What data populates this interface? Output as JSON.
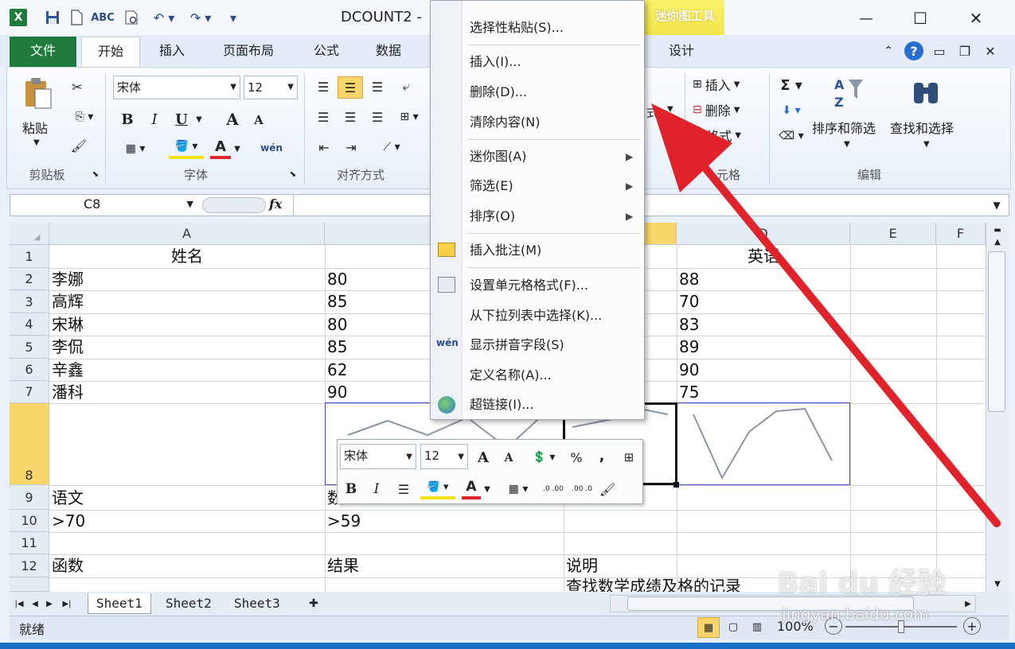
{
  "window": {
    "title": "DCOUNT2 -",
    "close_glyph": "✕",
    "maximize_glyph": "☐",
    "minimize_glyph": "—"
  },
  "context_tab_group": "迷你图工具",
  "tabs": [
    "文件",
    "开始",
    "插入",
    "页面布局",
    "公式",
    "数据",
    "设计"
  ],
  "ribbon": {
    "paste_label": "粘贴",
    "font_name": "宋体",
    "font_size": "12",
    "insert_label": "插入",
    "delete_label": "删除",
    "format_label": "格式",
    "format_partial": "式",
    "sort_filter_label": "排序和筛选",
    "find_select_label": "查找和选择",
    "group_labels": {
      "clipboard": "剪贴板",
      "font": "字体",
      "alignment": "对齐方式",
      "cells": "单元格",
      "cells_partial": "元格",
      "editing": "编辑"
    },
    "bold": "B",
    "italic": "I",
    "underline": "U",
    "grow_font": "A",
    "shrink_font": "A",
    "font_color": "A",
    "phonetic": "wén"
  },
  "formula_bar": {
    "name_box": "C8",
    "fx": "fx",
    "formula": ""
  },
  "columns": [
    "A",
    "C",
    "D",
    "E",
    "F"
  ],
  "rows": [
    {
      "num": "1",
      "a": "姓名",
      "b": "",
      "d": "英语"
    },
    {
      "num": "2",
      "a": "李娜",
      "b": "80",
      "d": "88"
    },
    {
      "num": "3",
      "a": "高辉",
      "b": "85",
      "d": "70"
    },
    {
      "num": "4",
      "a": "宋琳",
      "b": "80",
      "d": "83"
    },
    {
      "num": "5",
      "a": "李侃",
      "b": "85",
      "d": "89"
    },
    {
      "num": "6",
      "a": "辛鑫",
      "b": "62",
      "d": "90"
    },
    {
      "num": "7",
      "a": "潘科",
      "b": "90",
      "d": "75"
    },
    {
      "num": "8",
      "a": "",
      "b": "",
      "d": ""
    },
    {
      "num": "9",
      "a": "语文",
      "b": "数",
      "d": ""
    },
    {
      "num": "10",
      "a": ">70",
      "b": ">59",
      "d": ""
    },
    {
      "num": "11",
      "a": "",
      "b": "",
      "d": ""
    },
    {
      "num": "12",
      "a": "函数",
      "b": "结果",
      "c": "说明",
      "d": ""
    }
  ],
  "row13_c": "查找数学成绩及格的记录",
  "context_menu": {
    "items": [
      {
        "label": "选择性粘贴(S)...",
        "arrow": false
      },
      {
        "label": "插入(I)...",
        "arrow": false
      },
      {
        "label": "删除(D)...",
        "arrow": false
      },
      {
        "label": "清除内容(N)",
        "arrow": false
      },
      {
        "label": "迷你图(A)",
        "arrow": true
      },
      {
        "label": "筛选(E)",
        "arrow": true
      },
      {
        "label": "排序(O)",
        "arrow": true
      },
      {
        "label": "插入批注(M)",
        "arrow": false
      },
      {
        "label": "设置单元格格式(F)...",
        "arrow": false
      },
      {
        "label": "从下拉列表中选择(K)...",
        "arrow": false
      },
      {
        "label": "显示拼音字段(S)",
        "arrow": false
      },
      {
        "label": "定义名称(A)...",
        "arrow": false
      },
      {
        "label": "超链接(I)...",
        "arrow": false
      }
    ],
    "arrow_glyph": "▶"
  },
  "mini_toolbar": {
    "font": "宋体",
    "size": "12",
    "percent": "%",
    "comma": ",",
    "bold": "B",
    "italic": "I",
    "font_color": "A",
    "inc_decimal": ".0 .00",
    "dec_decimal": ".00 .0"
  },
  "sheets": [
    "Sheet1",
    "Sheet2",
    "Sheet3"
  ],
  "status": {
    "ready": "就绪",
    "zoom": "100%",
    "zoom_minus": "−",
    "zoom_plus": "+"
  },
  "watermark": {
    "brand": "Bai du 经验",
    "url": "jingyan.baidu.com"
  },
  "colors": {
    "excel_green": "#1e7b3c",
    "accent_red": "#e0222a",
    "sparkline": "#8a96a8",
    "selection": "#f7c74a"
  }
}
